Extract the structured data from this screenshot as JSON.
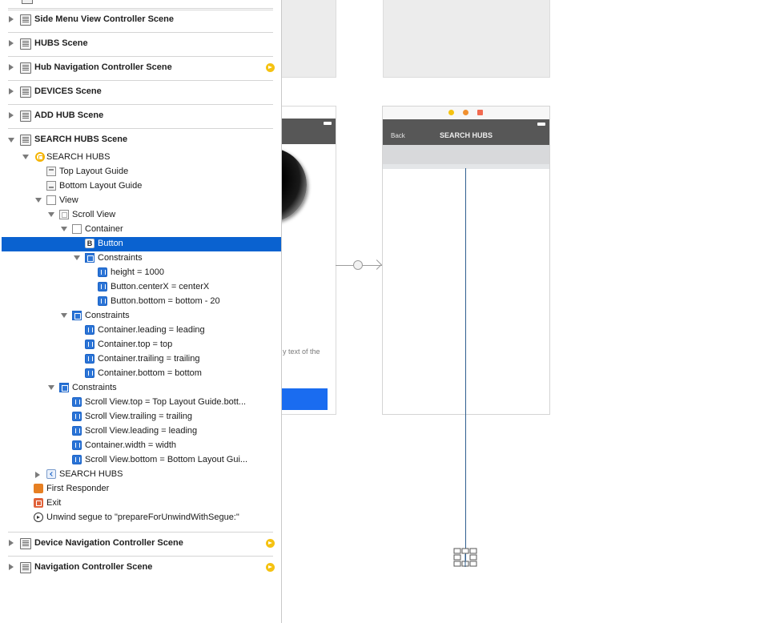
{
  "scenes_top": [
    {
      "label": "Side Menu View Controller Scene",
      "warning": false
    },
    {
      "label": "HUBS Scene",
      "warning": false
    },
    {
      "label": "Hub Navigation Controller Scene",
      "warning": true
    },
    {
      "label": "DEVICES Scene",
      "warning": false
    },
    {
      "label": "ADD HUB Scene",
      "warning": false
    },
    {
      "label": "SEARCH HUBS Scene",
      "warning": false
    }
  ],
  "tree": {
    "vc": "SEARCH HUBS",
    "top_guide": "Top Layout Guide",
    "bottom_guide": "Bottom Layout Guide",
    "view": "View",
    "scroll_view": "Scroll View",
    "container": "Container",
    "button": "Button",
    "button_icon_letter": "B",
    "constraints_label": "Constraints",
    "button_constraints": [
      "height = 1000",
      "Button.centerX = centerX",
      "Button.bottom = bottom - 20"
    ],
    "container_constraints": [
      "Container.leading = leading",
      "Container.top = top",
      "Container.trailing = trailing",
      "Container.bottom = bottom"
    ],
    "scroll_constraints": [
      "Scroll View.top = Top Layout Guide.bott...",
      "Scroll View.trailing = trailing",
      "Scroll View.leading = leading",
      "Container.width = width",
      "Scroll View.bottom = Bottom Layout Gui..."
    ],
    "nav_item": "SEARCH HUBS",
    "first_responder": "First Responder",
    "exit": "Exit",
    "unwind": "Unwind segue to \"prepareForUnwindWithSegue:\""
  },
  "scenes_bottom": [
    {
      "label": "Device Navigation Controller Scene",
      "warning": true
    },
    {
      "label": "Navigation Controller Scene",
      "warning": true
    }
  ],
  "canvas": {
    "mid_text": "y text of the ",
    "right_back": "Back",
    "right_title": "SEARCH HUBS",
    "dock_colors": [
      "#f5c211",
      "#f0902f",
      "#f26a50"
    ]
  }
}
